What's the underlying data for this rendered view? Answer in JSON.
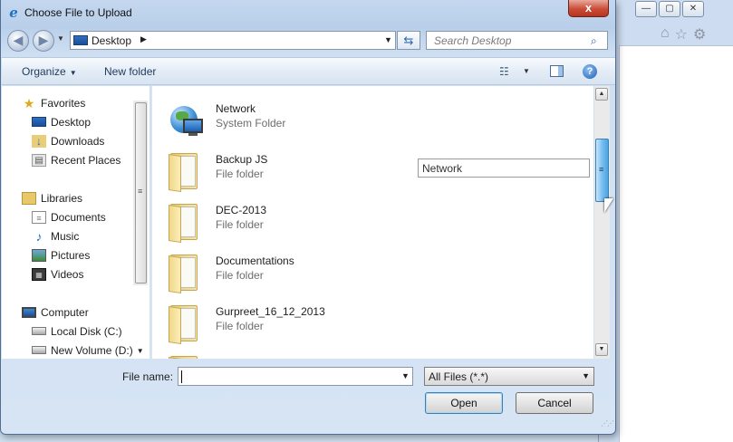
{
  "dialog": {
    "title": "Choose File to Upload",
    "close_glyph": "x"
  },
  "navbar": {
    "back_glyph": "◀",
    "forward_glyph": "▶",
    "address_location": "Desktop",
    "address_separator": "▶",
    "search_placeholder": "Search Desktop"
  },
  "toolbar": {
    "organize_label": "Organize",
    "new_folder_label": "New folder",
    "help_glyph": "?"
  },
  "nav_pane": {
    "items": [
      {
        "label": "Favorites",
        "icon": "star-icon"
      },
      {
        "label": "Desktop",
        "icon": "desktop-icon"
      },
      {
        "label": "Downloads",
        "icon": "downloads-icon"
      },
      {
        "label": "Recent Places",
        "icon": "recent-places-icon"
      },
      {
        "label": "Libraries",
        "icon": "libraries-icon"
      },
      {
        "label": "Documents",
        "icon": "documents-icon"
      },
      {
        "label": "Music",
        "icon": "music-icon"
      },
      {
        "label": "Pictures",
        "icon": "pictures-icon"
      },
      {
        "label": "Videos",
        "icon": "videos-icon"
      },
      {
        "label": "Computer",
        "icon": "computer-icon"
      },
      {
        "label": "Local Disk (C:)",
        "icon": "local-disk-icon"
      },
      {
        "label": "New Volume (D:)",
        "icon": "volume-icon"
      }
    ]
  },
  "files": [
    {
      "name": "Network",
      "type": "System Folder",
      "icon": "network-icon"
    },
    {
      "name": "Backup JS",
      "type": "File folder",
      "icon": "folder-icon"
    },
    {
      "name": "DEC-2013",
      "type": "File folder",
      "icon": "folder-icon"
    },
    {
      "name": "Documentations",
      "type": "File folder",
      "icon": "folder-icon"
    },
    {
      "name": "Gurpreet_16_12_2013",
      "type": "File folder",
      "icon": "folder-icon"
    }
  ],
  "rename_box_value": "Network",
  "footer": {
    "file_name_label": "File name:",
    "file_name_value": "",
    "file_type_value": "All Files (*.*)",
    "open_label": "Open",
    "cancel_label": "Cancel"
  },
  "colors": {
    "accent": "#3c7fb1",
    "close": "#c94d38"
  }
}
